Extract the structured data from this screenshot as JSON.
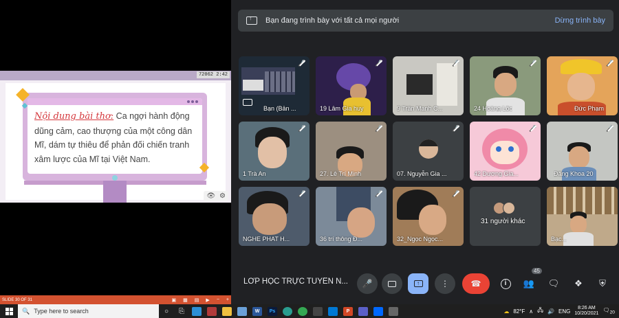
{
  "slide": {
    "counter": "72062",
    "counter_small": "2:42",
    "heading": "Nội dung bài thơ:",
    "body": " Ca ngợi hành động dũng cảm, cao thượng của một công dân Mĩ, dám tự thiêu để phản đối chiến tranh xâm lược của Mĩ tại Việt Nam."
  },
  "ppt_status": {
    "slide_label": "SLIDE 30 OF 31"
  },
  "meet": {
    "banner_text": "Bạn đang trình bày với tất cả mọi người",
    "stop_label": "Dừng trình bày",
    "tiles": [
      {
        "label": "Bạn (Bản ...",
        "muted": true
      },
      {
        "label": "19 Lâm Gia huy",
        "muted": true
      },
      {
        "label": "9 Trần Mạnh C...",
        "muted": true
      },
      {
        "label": "24 Hoàng Lộc",
        "muted": true
      },
      {
        "label": "Đức Phạm",
        "muted": true
      },
      {
        "label": "1 Trà An",
        "muted": true
      },
      {
        "label": "27. Lê Trí Minh",
        "muted": true
      },
      {
        "label": "07. Nguyễn Gia ...",
        "muted": true
      },
      {
        "label": "42 Dương Gia...",
        "muted": true
      },
      {
        "label": "Đăng Khoa 20",
        "muted": true
      },
      {
        "label": "NGHE PHAT H...",
        "muted": true
      },
      {
        "label": "36 trí thông Đ...",
        "muted": true
      },
      {
        "label": "32_Ngọc Ngọc...",
        "muted": true
      },
      {
        "label": "31 người khác",
        "muted": false
      },
      {
        "label": "Bạc...",
        "muted": false
      }
    ],
    "meeting_title": "LỚP HỌC TRỰC TUYẾN N...",
    "participant_count": "45"
  },
  "taskbar": {
    "search_placeholder": "Type here to search",
    "temperature": "82°F",
    "language": "ENG",
    "time": "8:26 AM",
    "date": "10/20/2021",
    "notification_count": "20"
  }
}
